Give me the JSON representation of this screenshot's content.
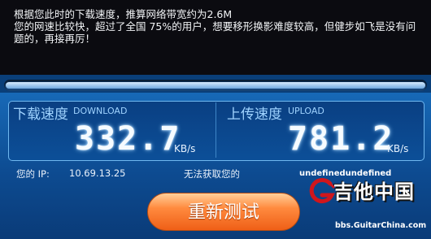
{
  "message": "根据您此时的下载速度，推算网络带宽约为2.6M\n您的网速比较快，超过了全国 75%的用户，想要移形换影难度较高，但健步如飞是没有问题的，再接再厉！",
  "progress": {
    "value": 1.0
  },
  "download": {
    "label_cn": "下载速度",
    "label_en": "DOWNLOAD",
    "value": "332.7",
    "unit": "KB/s"
  },
  "upload": {
    "label_cn": "上传速度",
    "label_en": "UPLOAD",
    "value": "781.2",
    "unit": "KB/s"
  },
  "ip": {
    "label": "您的 IP:",
    "value": "10.69.13.25"
  },
  "location": {
    "text": "无法获取您的",
    "value": "undefinedundefined"
  },
  "retest_button": {
    "label": "重新测试"
  },
  "logo": {
    "text": "吉他中国",
    "url": "bbs.GuitarChina.com"
  },
  "colors": {
    "accent": "#ff7a2e",
    "panel": "#0d4b91",
    "digit_glow": "#9ed4ff"
  },
  "icons": {
    "logo": "guitar-g-logo-icon"
  }
}
